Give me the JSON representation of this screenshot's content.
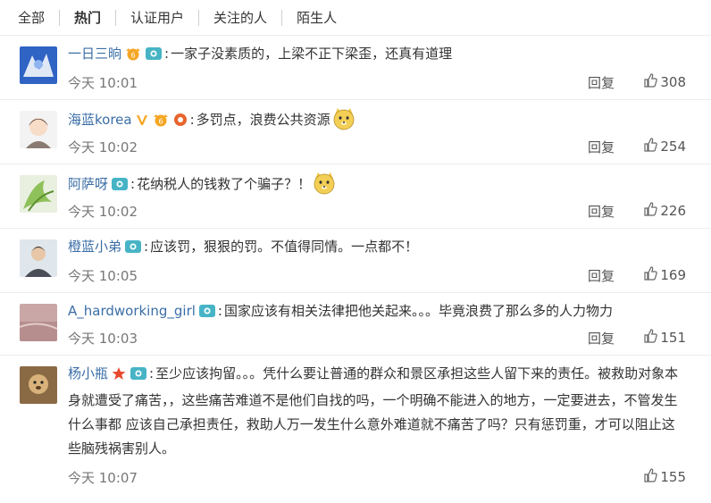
{
  "tabs": [
    {
      "label": "全部"
    },
    {
      "label": "热门"
    },
    {
      "label": "认证用户"
    },
    {
      "label": "关注的人"
    },
    {
      "label": "陌生人"
    }
  ],
  "reply_label": "回复",
  "colors": {
    "username": "#3b6ea6",
    "gold_v": "#f5a623",
    "member_badge": "#47b4c6",
    "star": "#e8482c"
  },
  "comments": [
    {
      "user": "一日三晌",
      "text": "一家子没素质的，上梁不正下梁歪，还真有道理",
      "time": "今天 10:01",
      "likes": "308",
      "badges": [
        "level-crown-badge",
        "member-badge"
      ]
    },
    {
      "user": "海蓝korea",
      "text": "多罚点，浪费公共资源",
      "time": "今天 10:02",
      "likes": "254",
      "badges": [
        "v-verified-badge",
        "level-crown-badge",
        "fan-badge"
      ],
      "emoji": "doge-emoji"
    },
    {
      "user": "阿萨呀",
      "text": "花纳税人的钱救了个骗子？！",
      "time": "今天 10:02",
      "likes": "226",
      "badges": [
        "member-badge"
      ],
      "emoji": "doge-emoji"
    },
    {
      "user": "橙蓝小弟",
      "text": "应该罚，狠狠的罚。不值得同情。一点都不！",
      "time": "今天 10:05",
      "likes": "169",
      "badges": [
        "member-badge"
      ]
    },
    {
      "user": "A_hardworking_girl",
      "text": "国家应该有相关法律把他关起来。。。毕竟浪费了那么多的人力物力",
      "time": "今天 10:03",
      "likes": "151",
      "badges": [
        "member-badge"
      ]
    },
    {
      "user": "杨小瓶",
      "text": "至少应该拘留。。。凭什么要让普通的群众和景区承担这些人留下来的责任。被救助对象本身就遭受了痛苦，，这些痛苦难道不是他们自找的吗，一个明确不能进入的地方，一定要进去，不管发生什么事都 应该自己承担责任，救助人万一发生什么意外难道就不痛苦了吗？只有惩罚重，才可以阻止这些脑残祸害别人。",
      "time": "今天 10:07",
      "likes": "155",
      "badges": [
        "star-badge",
        "member-badge"
      ]
    }
  ]
}
